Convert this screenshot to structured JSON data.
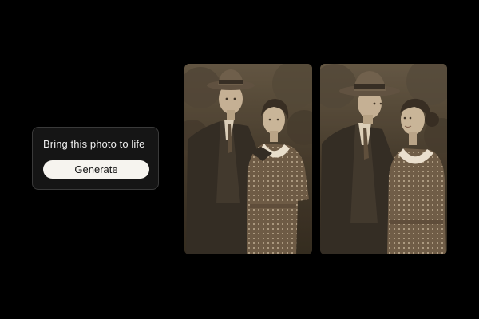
{
  "prompt": {
    "text": "Bring this photo to life",
    "button_label": "Generate"
  },
  "photos": [
    {
      "name": "original-vintage-photo",
      "description_icon": "sepia-couple-portrait"
    },
    {
      "name": "animated-vintage-photo",
      "description_icon": "sepia-couple-portrait-facing"
    }
  ],
  "colors": {
    "background": "#000000",
    "card_background": "#151515",
    "card_border": "#3a3a3a",
    "button_background": "#f6f4ef",
    "text_light": "#f0f0f0",
    "sepia_dark": "#2a221a",
    "sepia_mid": "#6b5a45",
    "sepia_light": "#d8c7ab"
  }
}
